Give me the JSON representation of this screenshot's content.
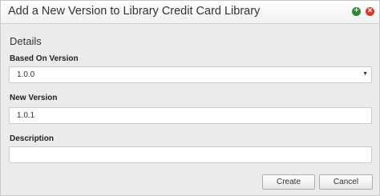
{
  "dialog": {
    "title": "Add a New Version to Library Credit Card Library",
    "add_icon": "plus-circle-icon",
    "close_icon": "close-circle-icon",
    "accent_green": "#2f8a2f",
    "accent_red": "#d63a2f"
  },
  "details": {
    "section_title": "Details",
    "based_on_label": "Based On Version",
    "based_on_value": "1.0.0",
    "new_version_label": "New Version",
    "new_version_value": "1.0.1",
    "description_label": "Description",
    "description_value": ""
  },
  "actions": {
    "create_label": "Create",
    "cancel_label": "Cancel"
  }
}
